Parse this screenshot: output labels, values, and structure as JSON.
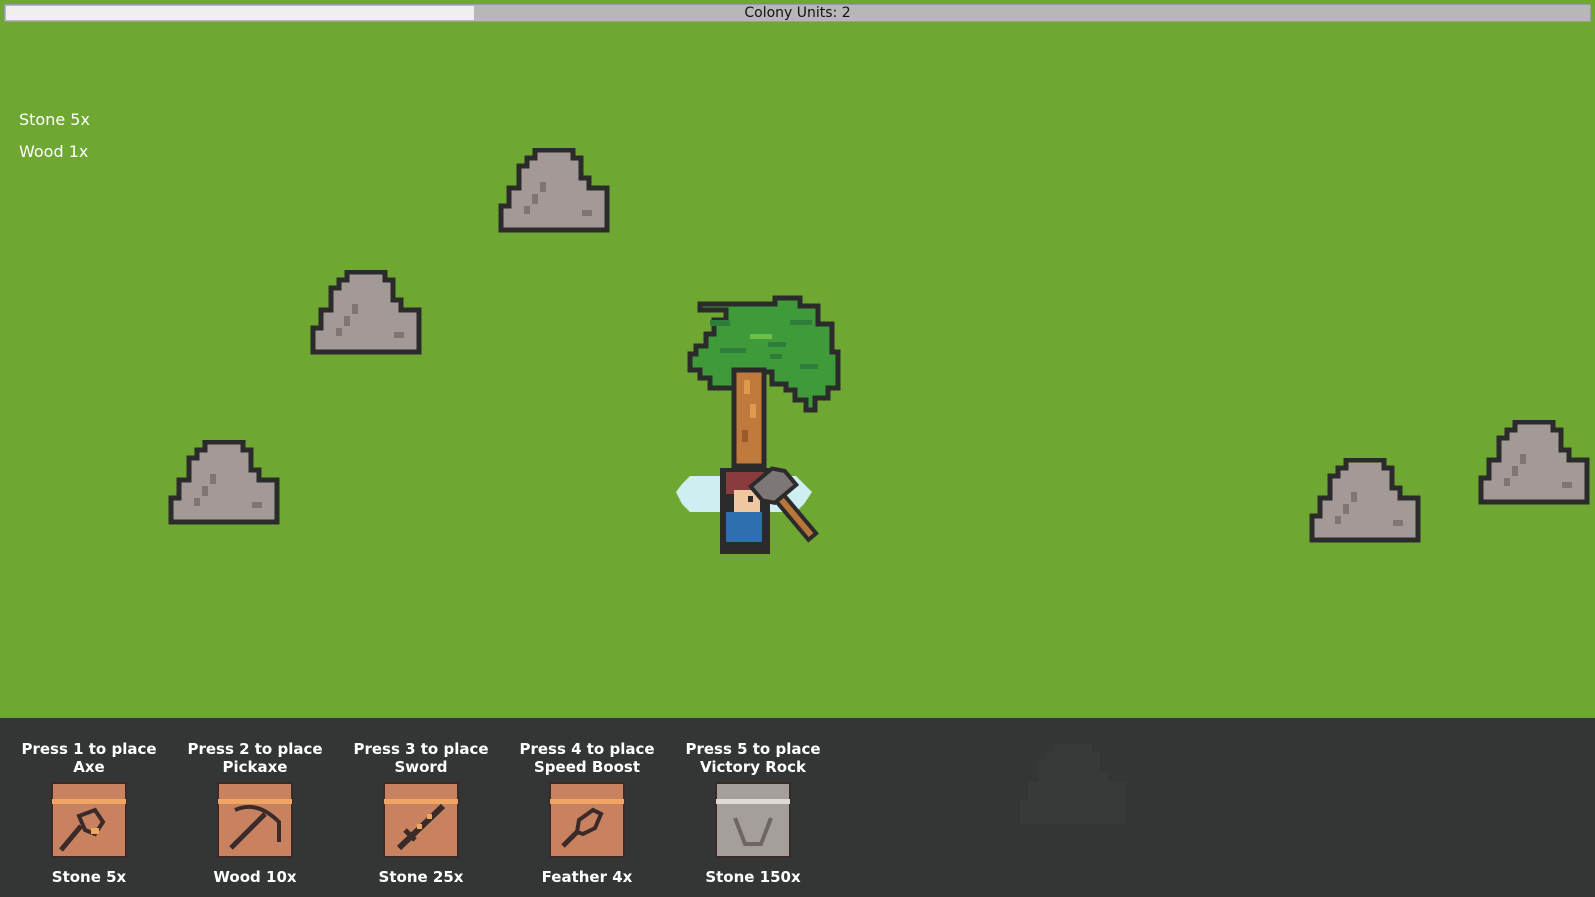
{
  "hud": {
    "progress_label": "Colony Units: 2",
    "progress_fraction": 0.295
  },
  "inventory": {
    "items": [
      {
        "text": "Stone 5x"
      },
      {
        "text": "Wood 1x"
      }
    ]
  },
  "world": {
    "entities": [
      "rock",
      "rock",
      "rock",
      "rock",
      "rock",
      "tree",
      "player-with-axe"
    ]
  },
  "toolbar": {
    "slots": [
      {
        "key_label": "Press 1 to place",
        "item": "Axe",
        "cost": "Stone 5x",
        "icon": "axe-icon"
      },
      {
        "key_label": "Press 2 to place",
        "item": "Pickaxe",
        "cost": "Wood 10x",
        "icon": "pickaxe-icon"
      },
      {
        "key_label": "Press 3 to place",
        "item": "Sword",
        "cost": "Stone 25x",
        "icon": "sword-icon"
      },
      {
        "key_label": "Press 4 to place",
        "item": "Speed Boost",
        "cost": "Feather 4x",
        "icon": "feather-icon"
      },
      {
        "key_label": "Press 5 to place",
        "item": "Victory Rock",
        "cost": "Stone 150x",
        "icon": "victory-rock-icon"
      }
    ]
  },
  "colors": {
    "grass": "#6fa733",
    "toolbar_bg": "#333635",
    "rock": "#a39a98",
    "outline": "#2b2b2b",
    "slot_orange": "#c9825f",
    "slot_grey": "#a59f9c"
  }
}
